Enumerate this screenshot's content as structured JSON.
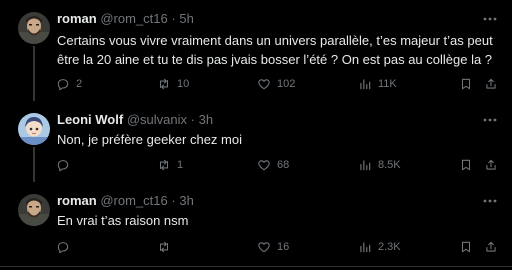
{
  "tweets": [
    {
      "name": "roman",
      "handle": "@rom_ct16",
      "sep": "·",
      "time": "5h",
      "text": "Certains vous vivre vraiment dans un univers parallèle, t’es majeur t’as peut être la 20 aine et tu te dis pas jvais bosser l’été ? On est pas au collège la ?",
      "replies": "2",
      "reposts": "10",
      "likes": "102",
      "views": "11K"
    },
    {
      "name": "Leoni Wolf",
      "handle": "@sulvanix",
      "sep": "·",
      "time": "3h",
      "text": "Non, je préfère geeker chez moi",
      "replies": "",
      "reposts": "1",
      "likes": "68",
      "views": "8.5K"
    },
    {
      "name": "roman",
      "handle": "@rom_ct16",
      "sep": "·",
      "time": "3h",
      "text": "En vrai t’as raison nsm",
      "replies": "",
      "reposts": "",
      "likes": "16",
      "views": "2.3K"
    }
  ],
  "icons": {
    "more": "more-horizontal-icon",
    "reply": "reply-icon",
    "repost": "repost-icon",
    "like": "heart-icon",
    "views": "views-icon",
    "bookmark": "bookmark-icon",
    "share": "share-icon"
  },
  "colors": {
    "background": "#000000",
    "text": "#e7e9ea",
    "muted": "#71767b",
    "divider": "#2f3336"
  }
}
